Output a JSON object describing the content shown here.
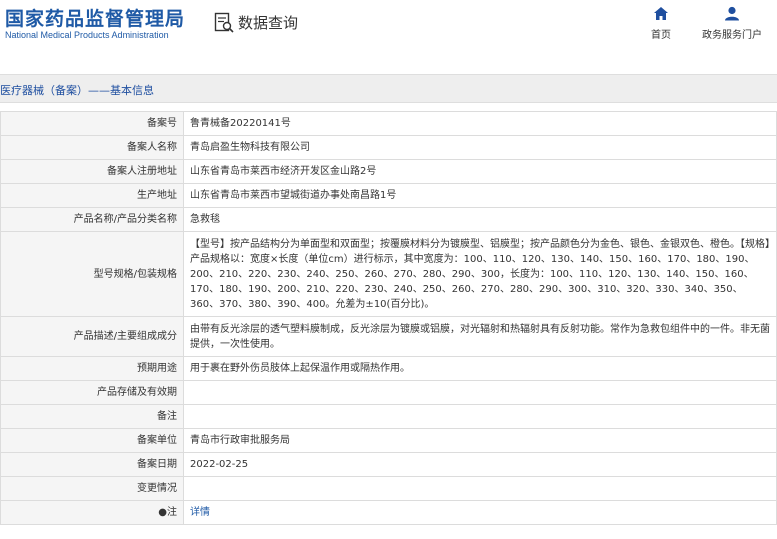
{
  "header": {
    "logo_cn": "国家药品监督管理局",
    "logo_en": "National Medical Products Administration",
    "db_title": "数据查询",
    "nav": [
      {
        "label": "首页",
        "icon": "home-icon"
      },
      {
        "label": "政务服务门户",
        "icon": "user-icon"
      }
    ]
  },
  "breadcrumb": "医疗器械（备案）——基本信息",
  "colors": {
    "brand": "#1f5aa6",
    "label_bg": "#f5f5f5",
    "border": "#dcdcdc"
  },
  "rows": [
    {
      "label": "备案号",
      "value": "鲁青械备20220141号"
    },
    {
      "label": "备案人名称",
      "value": "青岛启盈生物科技有限公司"
    },
    {
      "label": "备案人注册地址",
      "value": "山东省青岛市莱西市经济开发区金山路2号"
    },
    {
      "label": "生产地址",
      "value": "山东省青岛市莱西市望城街道办事处南昌路1号"
    },
    {
      "label": "产品名称/产品分类名称",
      "value": "急救毯"
    },
    {
      "label": "型号规格/包装规格",
      "value": "【型号】按产品结构分为单面型和双面型；按覆膜材料分为镀膜型、铝膜型；按产品颜色分为金色、银色、金银双色、橙色。【规格】产品规格以：宽度×长度（单位cm）进行标示，其中宽度为：100、110、120、130、140、150、160、170、180、190、200、210、220、230、240、250、260、270、280、290、300，长度为：100、110、120、130、140、150、160、170、180、190、200、210、220、230、240、250、260、270、280、290、300、310、320、330、340、350、360、370、380、390、400。允差为±10(百分比)。"
    },
    {
      "label": "产品描述/主要组成成分",
      "value": "由带有反光涂层的透气塑料膜制成，反光涂层为镀膜或铝膜，对光辐射和热辐射具有反射功能。常作为急救包组件中的一件。非无菌提供，一次性使用。"
    },
    {
      "label": "预期用途",
      "value": "用于裹在野外伤员肢体上起保温作用或隔热作用。"
    },
    {
      "label": "产品存储及有效期",
      "value": ""
    },
    {
      "label": "备注",
      "value": ""
    },
    {
      "label": "备案单位",
      "value": "青岛市行政审批服务局"
    },
    {
      "label": "备案日期",
      "value": "2022-02-25"
    },
    {
      "label": "变更情况",
      "value": ""
    },
    {
      "label": "●注",
      "value": "详情"
    }
  ]
}
